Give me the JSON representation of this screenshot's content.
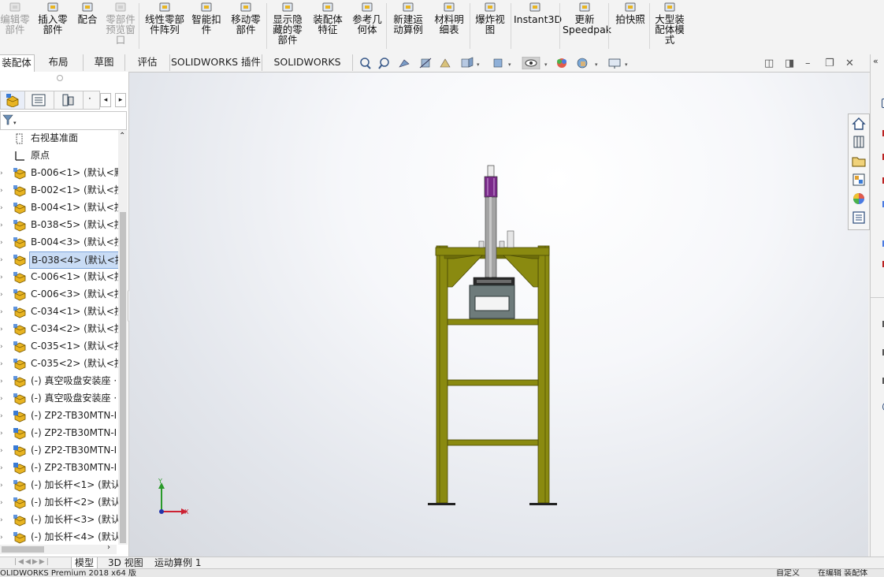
{
  "ribbon": {
    "buttons": [
      {
        "label": "编辑零\n部件",
        "icon": "edit-component-icon",
        "disabled": true
      },
      {
        "label": "插入零\n部件",
        "icon": "insert-component-icon",
        "disabled": false
      },
      {
        "label": "配合",
        "icon": "mate-icon",
        "disabled": false
      },
      {
        "label": "零部件\n预览窗\n口",
        "icon": "component-preview-icon",
        "disabled": true
      },
      {
        "label": "线性零部\n件阵列",
        "icon": "linear-pattern-icon",
        "disabled": false
      },
      {
        "label": "智能扣\n件",
        "icon": "smart-fasteners-icon",
        "disabled": false
      },
      {
        "label": "移动零\n部件",
        "icon": "move-component-icon",
        "disabled": false
      },
      {
        "label": "显示隐\n藏的零\n部件",
        "icon": "show-hidden-icon",
        "disabled": false
      },
      {
        "label": "装配体\n特征",
        "icon": "assembly-features-icon",
        "disabled": false
      },
      {
        "label": "参考几\n何体",
        "icon": "reference-geometry-icon",
        "disabled": false
      },
      {
        "label": "新建运\n动算例",
        "icon": "new-motion-study-icon",
        "disabled": false
      },
      {
        "label": "材料明\n细表",
        "icon": "bill-of-materials-icon",
        "disabled": false
      },
      {
        "label": "爆炸视\n图",
        "icon": "exploded-view-icon",
        "disabled": false
      },
      {
        "label": "Instant3D",
        "icon": "instant3d-icon",
        "disabled": false
      },
      {
        "label": "更新\nSpeedpak",
        "icon": "speedpak-icon",
        "disabled": false
      },
      {
        "label": "拍快照",
        "icon": "snapshot-icon",
        "disabled": false
      },
      {
        "label": "大型装\n配体模\n式",
        "icon": "large-assembly-icon",
        "disabled": false
      }
    ]
  },
  "command_tabs": [
    "装配体",
    "布局",
    "草图",
    "评估",
    "SOLIDWORKS 插件",
    "SOLIDWORKS MBD"
  ],
  "tree": {
    "items": [
      {
        "label": "右视基准面",
        "icon": "plane-icon",
        "expander": false,
        "selected": false
      },
      {
        "label": "原点",
        "icon": "origin-icon",
        "expander": false,
        "selected": false
      },
      {
        "label": "B-006<1> (默认<默",
        "icon": "assembly-icon",
        "expander": true,
        "selected": false
      },
      {
        "label": "B-002<1> (默认<按",
        "icon": "assembly-icon",
        "expander": true,
        "selected": false
      },
      {
        "label": "B-004<1> (默认<按",
        "icon": "assembly-icon",
        "expander": true,
        "selected": false
      },
      {
        "label": "B-038<5> (默认<按",
        "icon": "assembly-icon",
        "expander": true,
        "selected": false
      },
      {
        "label": "B-004<3> (默认<按",
        "icon": "assembly-icon",
        "expander": true,
        "selected": false
      },
      {
        "label": "B-038<4> (默认<按",
        "icon": "assembly-icon",
        "expander": true,
        "selected": true
      },
      {
        "label": "C-006<1> (默认<按",
        "icon": "assembly-icon",
        "expander": true,
        "selected": false
      },
      {
        "label": "C-006<3> (默认<按",
        "icon": "assembly-icon",
        "expander": true,
        "selected": false
      },
      {
        "label": "C-034<1> (默认<按",
        "icon": "assembly-icon",
        "expander": true,
        "selected": false
      },
      {
        "label": "C-034<2> (默认<按",
        "icon": "assembly-icon",
        "expander": true,
        "selected": false
      },
      {
        "label": "C-035<1> (默认<按",
        "icon": "assembly-icon",
        "expander": true,
        "selected": false
      },
      {
        "label": "C-035<2> (默认<按",
        "icon": "assembly-icon",
        "expander": true,
        "selected": false
      },
      {
        "label": "(-) 真空吸盘安装座 ·",
        "icon": "assembly-icon",
        "expander": true,
        "selected": false
      },
      {
        "label": "(-) 真空吸盘安装座 ·",
        "icon": "assembly-icon",
        "expander": true,
        "selected": false
      },
      {
        "label": "(-) ZP2-TB30MTN-I",
        "icon": "assembly-blue-icon",
        "expander": true,
        "selected": false
      },
      {
        "label": "(-) ZP2-TB30MTN-I",
        "icon": "assembly-blue-icon",
        "expander": true,
        "selected": false
      },
      {
        "label": "(-) ZP2-TB30MTN-I",
        "icon": "assembly-blue-icon",
        "expander": true,
        "selected": false
      },
      {
        "label": "(-) ZP2-TB30MTN-I",
        "icon": "assembly-blue-icon",
        "expander": true,
        "selected": false
      },
      {
        "label": "(-) 加长杆<1> (默认",
        "icon": "assembly-icon",
        "expander": true,
        "selected": false
      },
      {
        "label": "(-) 加长杆<2> (默认",
        "icon": "assembly-icon",
        "expander": true,
        "selected": false
      },
      {
        "label": "(-) 加长杆<3> (默认",
        "icon": "assembly-icon",
        "expander": true,
        "selected": false
      },
      {
        "label": "(-) 加长杆<4> (默认",
        "icon": "assembly-icon",
        "expander": true,
        "selected": false
      }
    ]
  },
  "triad": {
    "x_label": "X",
    "y_label": "Y"
  },
  "bottom_tabs": [
    "模型",
    "3D 视图",
    "运动算例 1"
  ],
  "status": {
    "left": "OLIDWORKS Premium 2018 x64 版",
    "right1": "自定义",
    "right2": "在编辑 装配体"
  },
  "colors": {
    "frame": "#8a8a10",
    "frame_dark": "#5c5c05",
    "cylinder_band": "#7a2a8a",
    "box": "#6e7b7b",
    "selection": "#c9dcf5"
  }
}
